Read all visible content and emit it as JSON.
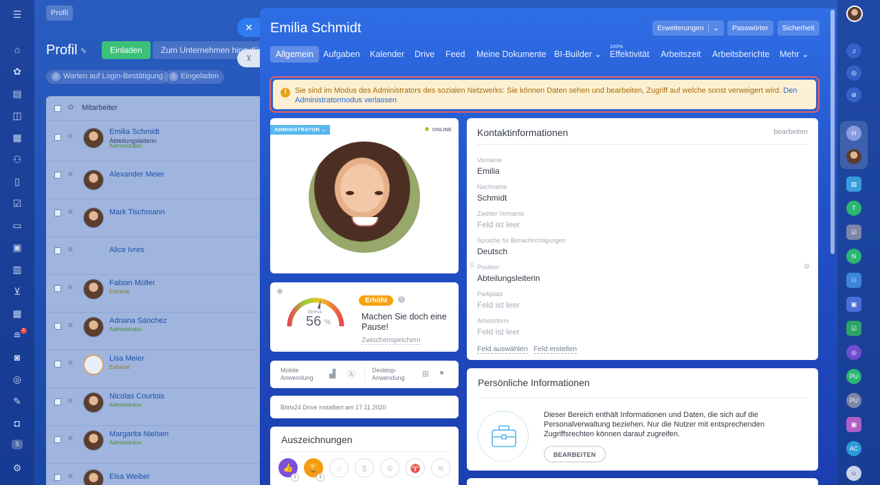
{
  "background": {
    "crumb": "Profil",
    "title": "Profil",
    "invite_button": "Einladen",
    "add_company_button": "Zum Unternehmen hinzufügen",
    "chips": [
      {
        "count": "0",
        "label": "Warten auf Login-Bestätigung"
      },
      {
        "count": "0",
        "label": "Eingeladen"
      }
    ],
    "list_header": "Mitarbeiter",
    "employees": [
      {
        "name": "Emilia Schmidt",
        "position": "Abteilungsleiterin",
        "role": "Administrator"
      },
      {
        "name": "Alexander Meier",
        "position": "",
        "role": ""
      },
      {
        "name": "Mark Tischmann",
        "position": "",
        "role": ""
      },
      {
        "name": "Alice Ivres",
        "position": "",
        "role": ""
      },
      {
        "name": "Fabian Müller",
        "position": "",
        "role": "Extranet"
      },
      {
        "name": "Adriana Sánchez",
        "position": "",
        "role": "Administrator"
      },
      {
        "name": "Lisa Meier",
        "position": "",
        "role": "Extranet"
      },
      {
        "name": "Nicolas Courtois",
        "position": "",
        "role": "Administrator"
      },
      {
        "name": "Margarita Nielsen",
        "position": "",
        "role": "Administrator"
      },
      {
        "name": "Elsa Weiber",
        "position": "",
        "role": ""
      }
    ],
    "notification_count": "1",
    "sidebar_badge": "S"
  },
  "slider": {
    "title": "Emilia Schmidt",
    "top_buttons": {
      "extensions": "Erweiterungen",
      "passwords": "Passwörter",
      "security": "Sicherheit"
    },
    "tabs": [
      {
        "label": "Allgemein"
      },
      {
        "label": "Aufgaben"
      },
      {
        "label": "Kalender"
      },
      {
        "label": "Drive"
      },
      {
        "label": "Feed"
      },
      {
        "label": "Meine Dokumente"
      },
      {
        "label": "BI-Builder"
      },
      {
        "label": "Effektivität",
        "sup": "100%"
      },
      {
        "label": "Arbeitszeit"
      },
      {
        "label": "Arbeitsberichte"
      },
      {
        "label": "Mehr"
      }
    ],
    "notice": {
      "text": "Sie sind im Modus des Administrators des sozialen Netzwerks: Sie können Daten sehen und bearbeiten, Zugriff auf welche sonst verweigert wird.",
      "link": "Den Administratormodus verlassen"
    },
    "profile": {
      "badge": "ADMINISTRATOR",
      "status": "ONLINE"
    },
    "stress": {
      "label": "Stress",
      "value": "56",
      "unit": "%",
      "level_fraction": 0.56,
      "state": "Erhöht",
      "message": "Machen Sie doch eine Pause!",
      "save": "Zwischenspeichern"
    },
    "apps": {
      "mobile": "Mobile Anwendung",
      "desktop": "Desktop-Anwendung"
    },
    "drive": "Bitrix24 Drive installiert am 17.11.2020",
    "awards": {
      "title": "Auszeichnungen",
      "counts": [
        "1",
        "1"
      ]
    },
    "contact": {
      "title": "Kontaktinformationen",
      "edit": "bearbeiten",
      "fields": [
        {
          "label": "Vorname",
          "value": "Emilia"
        },
        {
          "label": "Nachname",
          "value": "Schmidt"
        },
        {
          "label": "Zweiter Vorname",
          "value": "Feld ist leer"
        },
        {
          "label": "Sprache für Benachrichtigungen",
          "value": "Deutsch"
        },
        {
          "label": "Position",
          "value": "Abteilungsleiterin"
        },
        {
          "label": "Parkplatz",
          "value": "Feld ist leer"
        },
        {
          "label": "Arbeitsform",
          "value": "Feld ist leer"
        }
      ],
      "select_field": "Feld auswählen",
      "create_field": "Feld erstellen"
    },
    "personal": {
      "title": "Persönliche Informationen",
      "text": "Dieser Bereich enthält Informationen und Daten, die sich auf die Personalverwaltung beziehen. Nur die Nutzer mit entsprechenden Zugriffsrechten können darauf zugreifen.",
      "button": "BEARBEITEN"
    }
  },
  "right_sidebar": {
    "avatars": [
      "H",
      "T",
      "N",
      "PU",
      "PU",
      "AC"
    ]
  }
}
